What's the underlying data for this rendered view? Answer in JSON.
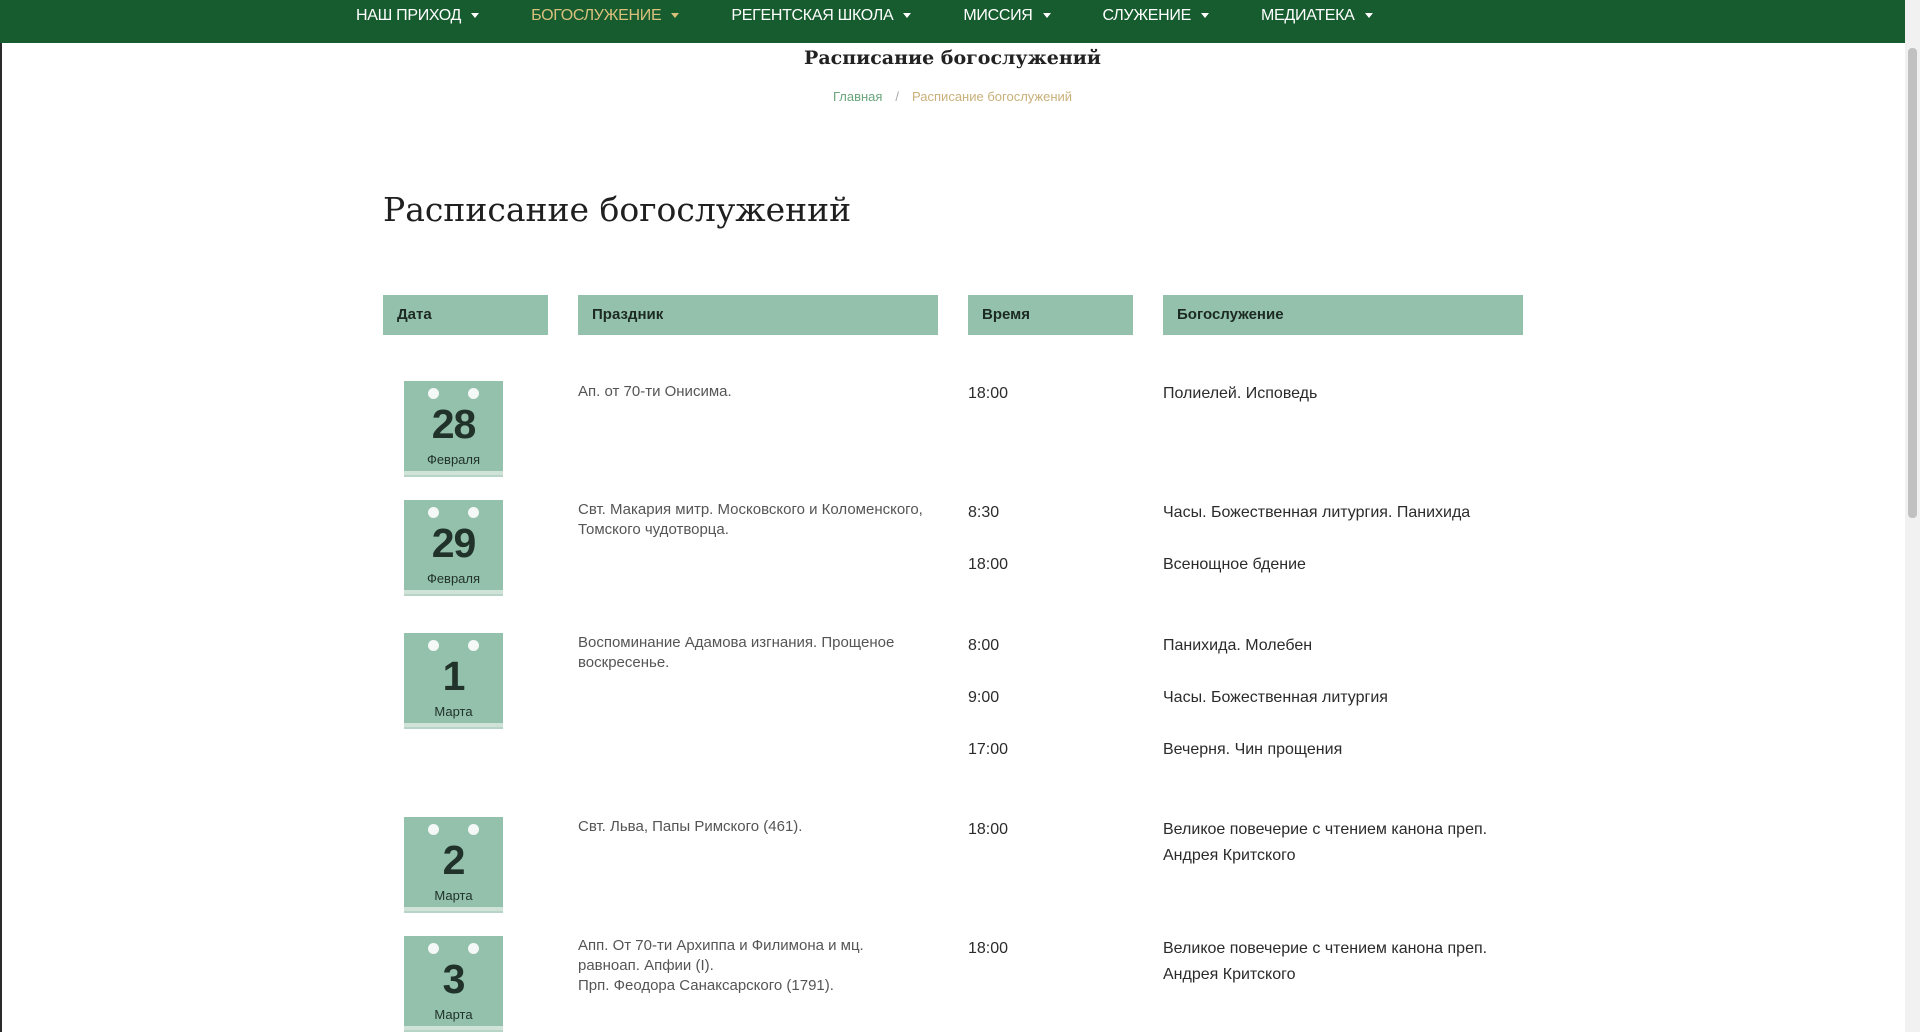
{
  "nav": {
    "items": [
      {
        "label": "Наш приход"
      },
      {
        "label": "Богослужение"
      },
      {
        "label": "Регентская школа"
      },
      {
        "label": "Миссия"
      },
      {
        "label": "Служение"
      },
      {
        "label": "Медиатека"
      }
    ],
    "active_index": 1
  },
  "header": {
    "title": "Расписание богослужений"
  },
  "breadcrumb": {
    "home": "Главная",
    "separator": "/",
    "current": "Расписание богослужений"
  },
  "page": {
    "heading": "Расписание богослужений"
  },
  "table": {
    "headers": {
      "date": "Дата",
      "holiday": "Праздник",
      "time": "Время",
      "service": "Богослужение"
    },
    "rows": [
      {
        "day": "28",
        "month": "Февраля",
        "holiday": "Ап. от 70-ти Онисима.",
        "services": [
          {
            "time": "18:00",
            "service": "Полиелей. Исповедь"
          }
        ]
      },
      {
        "day": "29",
        "month": "Февраля",
        "holiday": "Свт. Макария митр. Московского и Коломенского, Томского чудотворца.",
        "services": [
          {
            "time": "8:30",
            "service": "Часы. Божественная литургия. Панихида"
          },
          {
            "time": "18:00",
            "service": "Всенощное бдение"
          }
        ]
      },
      {
        "day": "1",
        "month": "Марта",
        "holiday": "Воспоминание Адамова изгнания. Прощеное воскресенье.",
        "services": [
          {
            "time": "8:00",
            "service": "Панихида. Молебен"
          },
          {
            "time": "9:00",
            "service": "Часы. Божественная литургия"
          },
          {
            "time": "17:00",
            "service": "Вечерня. Чин прощения"
          }
        ]
      },
      {
        "day": "2",
        "month": "Марта",
        "holiday": "Свт. Льва, Папы Римского (461).",
        "services": [
          {
            "time": "18:00",
            "service": "Великое повечерие с чтением канона преп. Андрея Критского"
          }
        ]
      },
      {
        "day": "3",
        "month": "Марта",
        "holiday_lines": [
          "Апп. От 70-ти Архиппа и Филимона и мц. равноап. Апфии (I).",
          "Прп. Феодора Санаксарского (1791)."
        ],
        "services": [
          {
            "time": "18:00",
            "service": "Великое повечерие с чтением канона преп. Андрея Критского"
          }
        ]
      }
    ]
  },
  "colors": {
    "nav_bg": "#165c2e",
    "nav_active": "#d9c07c",
    "accent": "#93c1ac",
    "breadcrumb_link": "#6aa57c",
    "breadcrumb_current": "#c9b07a"
  }
}
